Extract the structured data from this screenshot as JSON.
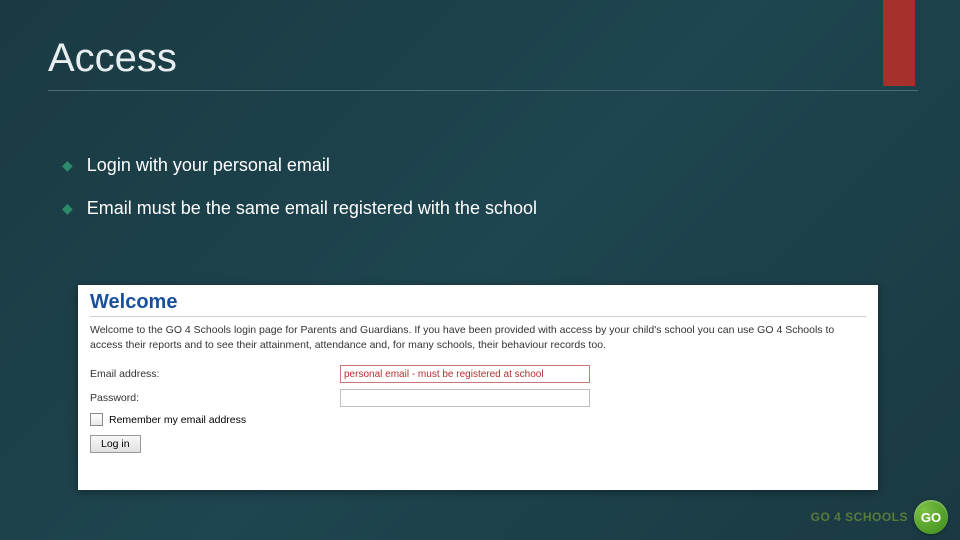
{
  "slide": {
    "title": "Access",
    "bullets": [
      "Login with your personal email",
      "Email must be the same email registered with the school"
    ]
  },
  "panel": {
    "heading": "Welcome",
    "intro": "Welcome to the GO 4 Schools login page for Parents and Guardians. If you have been provided with access by your child's school you can use GO 4 Schools to access their reports and to see their attainment, attendance and, for many schools, their behaviour records too.",
    "email_label": "Email address:",
    "email_value": "personal email - must be registered at school",
    "password_label": "Password:",
    "password_value": "",
    "remember_label": "Remember my email address",
    "login_button": "Log in"
  },
  "brand": {
    "name": "GO 4 SCHOOLS",
    "badge": "GO"
  }
}
